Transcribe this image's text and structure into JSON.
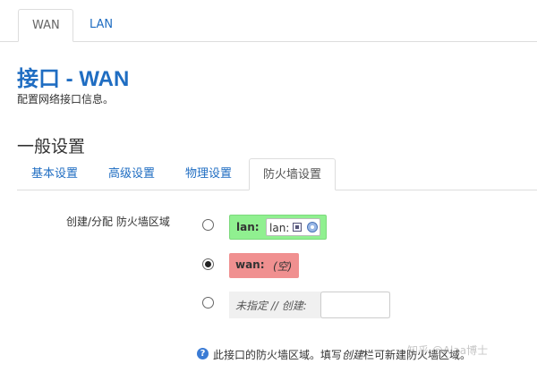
{
  "top_tabs": [
    {
      "label": "WAN",
      "active": true
    },
    {
      "label": "LAN",
      "active": false
    }
  ],
  "page": {
    "title": "接口 - WAN",
    "description": "配置网络接口信息。"
  },
  "section": {
    "title": "一般设置"
  },
  "sub_tabs": [
    {
      "label": "基本设置",
      "active": false
    },
    {
      "label": "高级设置",
      "active": false
    },
    {
      "label": "物理设置",
      "active": false
    },
    {
      "label": "防火墙设置",
      "active": true
    }
  ],
  "firewall_zone": {
    "label": "创建/分配 防火墙区域",
    "options": [
      {
        "zone": "lan:",
        "networks_label": "lan:",
        "selected": false,
        "color": "#90f090"
      },
      {
        "zone": "wan:",
        "empty_label": "(空)",
        "selected": true,
        "color": "#f09090"
      },
      {
        "label": "未指定 // 创建:",
        "input_value": "",
        "selected": false
      }
    ],
    "help": {
      "prefix": "此接口的防火墙区域。填写",
      "emphasis": "创建",
      "suffix": "栏可新建防火墙区域。"
    }
  },
  "watermark": "知乎 @Alaa博士",
  "colors": {
    "accent": "#1f6dc2"
  },
  "icons": [
    "network-port-icon",
    "wifi-icon",
    "help-icon"
  ]
}
